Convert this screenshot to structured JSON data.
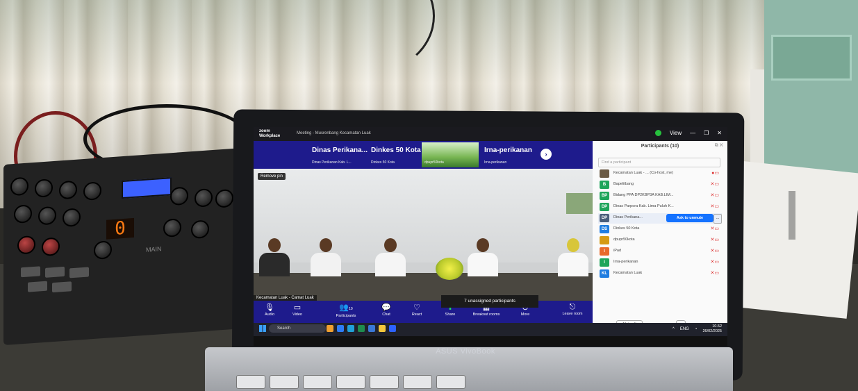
{
  "zoom": {
    "brand_line1": "zoom",
    "brand_line2": "Workplace",
    "meeting_title": "Meeting - Musrenbang Kecamatan Luak",
    "view_label": "View",
    "strip": [
      {
        "name": "Dinas Perikana...",
        "sub": "Dinas Perikanan Kab. L..."
      },
      {
        "name": "Dinkes 50 Kota",
        "sub": "Dinkes 50 Kota"
      },
      {
        "name": "",
        "sub": "dpupr50kota"
      },
      {
        "name": "Irna-perikanan",
        "sub": "Irna-perikanan"
      }
    ],
    "remove_pin": "Remove pin",
    "speaker_name": "Kecamatan Luak - Camat Luak",
    "unassigned": "7 unassigned participants",
    "controls": [
      {
        "icon": "mic",
        "label": "Audio"
      },
      {
        "icon": "video",
        "label": "Video"
      },
      {
        "icon": "participants",
        "label": "Participants",
        "count": "10"
      },
      {
        "icon": "chat",
        "label": "Chat"
      },
      {
        "icon": "react",
        "label": "React"
      },
      {
        "icon": "share",
        "label": "Share"
      },
      {
        "icon": "breakout",
        "label": "Breakout rooms"
      },
      {
        "icon": "more",
        "label": "More"
      },
      {
        "icon": "leave",
        "label": "Leave room"
      }
    ],
    "panel": {
      "title": "Participants (10)",
      "find_placeholder": "Find a participant",
      "participants": [
        {
          "initials": "",
          "name": "Kecamatan Luak - ... (Co-host, me)",
          "color": "#6b5a44"
        },
        {
          "initials": "B",
          "name": "Bapelitbang",
          "color": "#1ea55a"
        },
        {
          "initials": "BP",
          "name": "Bidang PPA DP2KBP3A KAB.LIM...",
          "color": "#1ea55a"
        },
        {
          "initials": "DP",
          "name": "Dinas Parpora Kab. Lima Puluh K...",
          "color": "#1ea55a"
        },
        {
          "initials": "DP",
          "name": "Dinas Perikana...",
          "color": "#4a5d7a"
        },
        {
          "initials": "DS",
          "name": "Dinkes 50 Kota",
          "color": "#1f7de0"
        },
        {
          "initials": "",
          "name": "dpupr50kota",
          "color": "#d59a12"
        },
        {
          "initials": "I",
          "name": "iPad",
          "color": "#e8692a"
        },
        {
          "initials": "I",
          "name": "Irna-perikanan",
          "color": "#1ea55a"
        },
        {
          "initials": "KL",
          "name": "Kecamatan Luak",
          "color": "#1f7de0"
        }
      ],
      "ask_to_unmute": "Ask to unmute",
      "mute_all": "Mute all",
      "more": "..."
    }
  },
  "taskbar": {
    "search": "Search",
    "lang": "ENG",
    "time": "10.52",
    "date": "26/02/2025"
  },
  "laptop": {
    "brand": "ASUS VivoBook"
  },
  "mixer": {
    "display_digit": "0",
    "main_label": "MAIN"
  }
}
